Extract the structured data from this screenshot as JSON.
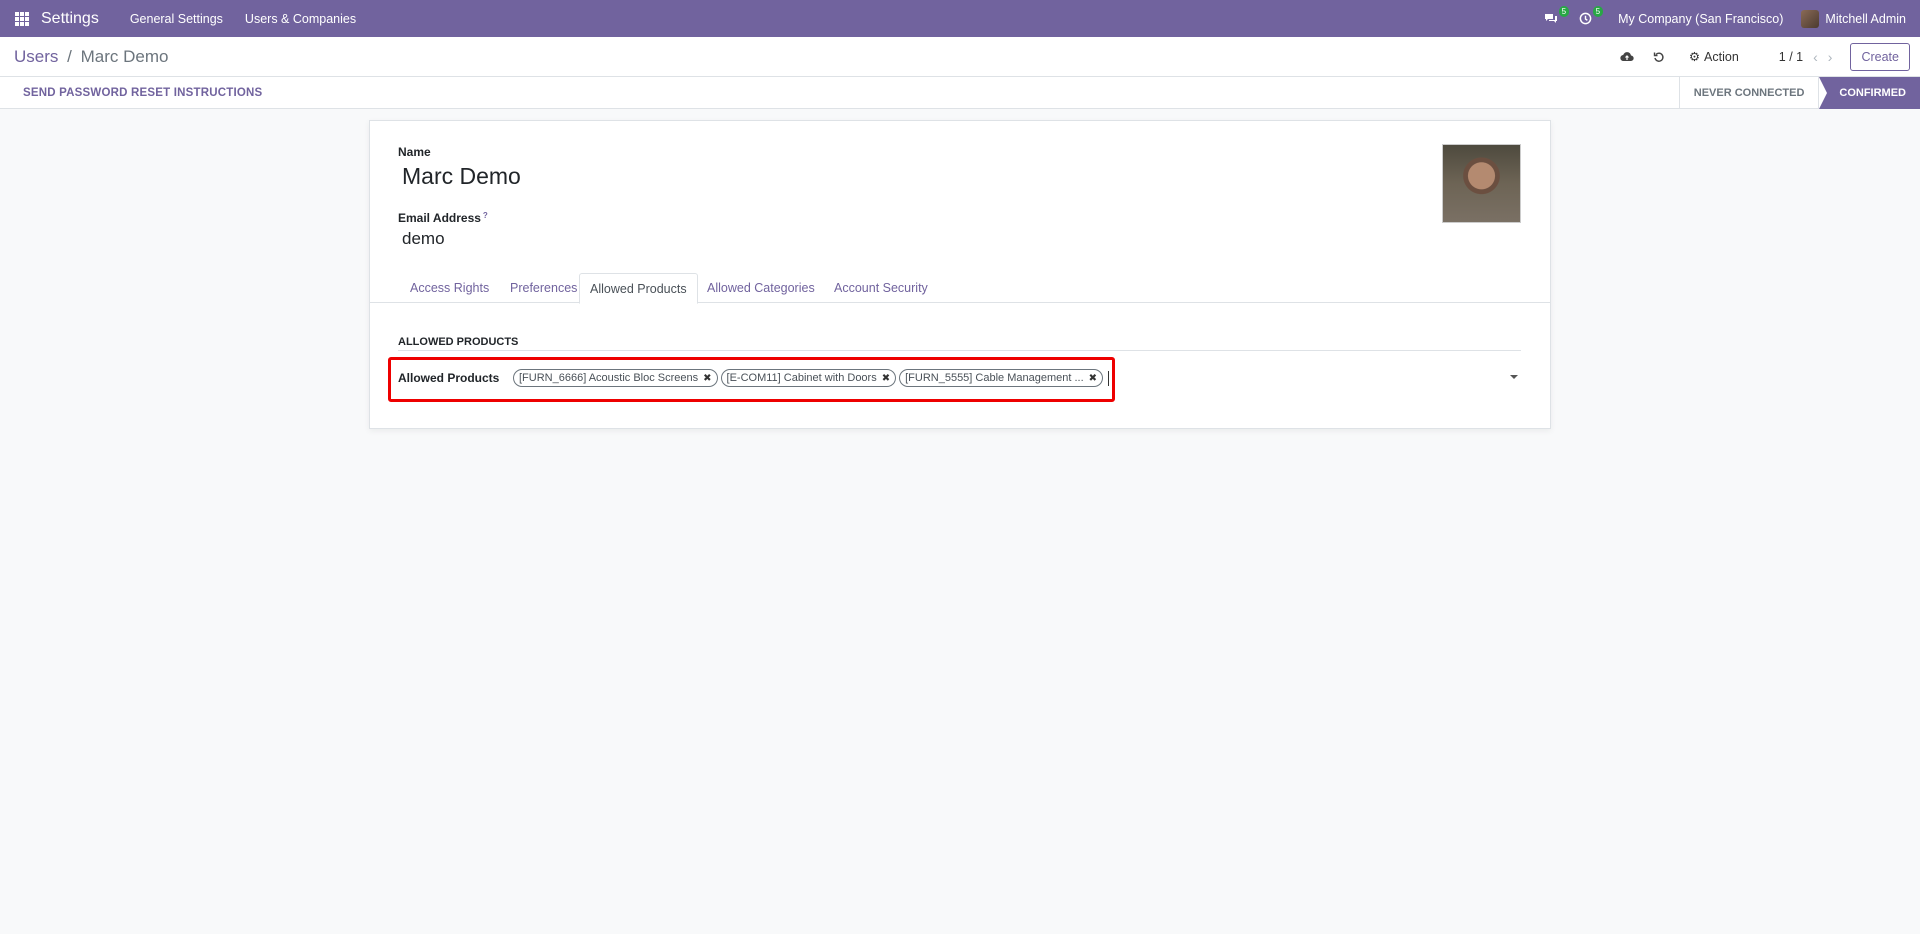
{
  "topbar": {
    "app_name": "Settings",
    "menu": [
      "General Settings",
      "Users & Companies"
    ],
    "messages_count": "5",
    "activities_count": "5",
    "company": "My Company (San Francisco)",
    "user": "Mitchell Admin",
    "bg_color": "#71639e"
  },
  "control": {
    "breadcrumb_parent": "Users",
    "breadcrumb_sep": "/",
    "breadcrumb_current": "Marc Demo",
    "action_label": "Action",
    "pager": "1 / 1",
    "create_label": "Create"
  },
  "status": {
    "reset_label": "SEND PASSWORD RESET INSTRUCTIONS",
    "stages": [
      "NEVER CONNECTED",
      "CONFIRMED"
    ],
    "active_stage": "CONFIRMED"
  },
  "form": {
    "name_label": "Name",
    "name_value": "Marc Demo",
    "email_label": "Email Address",
    "email_help": "?",
    "email_value": "demo",
    "tabs": [
      "Access Rights",
      "Preferences",
      "Allowed Products",
      "Allowed Categories",
      "Account Security"
    ],
    "active_tab": "Allowed Products",
    "section_title": "ALLOWED PRODUCTS",
    "field_label": "Allowed Products",
    "tags": [
      "[FURN_6666] Acoustic Bloc Screens",
      "[E-COM11] Cabinet with Doors",
      "[FURN_5555] Cable Management ..."
    ]
  }
}
